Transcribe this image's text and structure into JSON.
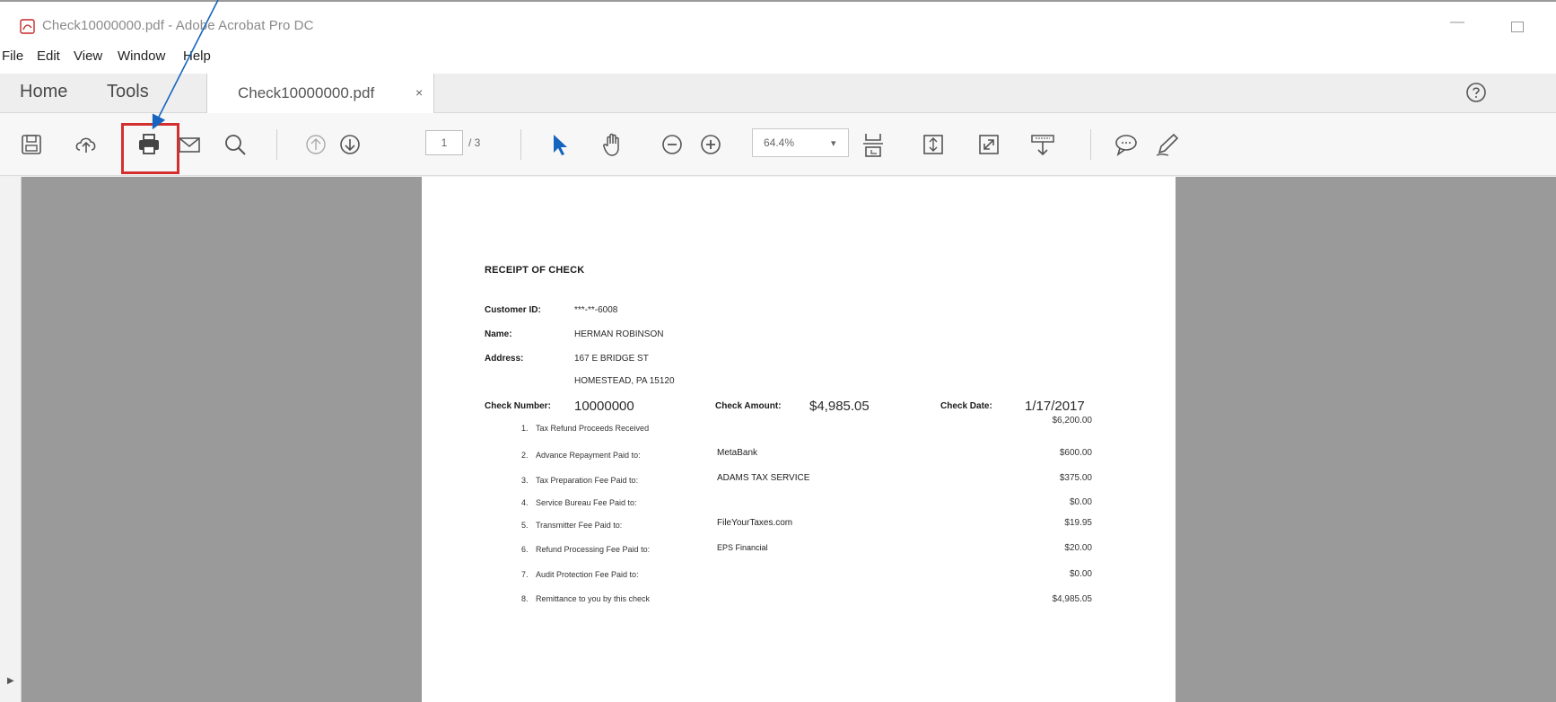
{
  "window": {
    "title": "Check10000000.pdf - Adobe Acrobat Pro DC"
  },
  "menu": [
    "File",
    "Edit",
    "View",
    "Window",
    "Help"
  ],
  "tabs": {
    "home": "Home",
    "tools": "Tools",
    "document": "Check10000000.pdf",
    "close": "×"
  },
  "toolbar": {
    "icons": [
      "save-icon",
      "cloud-upload-icon",
      "print-icon",
      "mail-icon",
      "search-icon",
      "page-up-icon",
      "page-down-icon",
      "select-arrow-icon",
      "hand-tool-icon",
      "zoom-out-icon",
      "zoom-in-icon",
      "fit-page-icon",
      "scroll-mode-icon",
      "full-screen-icon",
      "read-mode-icon",
      "comment-icon",
      "pen-icon"
    ],
    "page_current": "1",
    "page_total": "/ 3",
    "zoom": "64.4%",
    "highlight_color": "#d32f2f",
    "accent": "#1565c0"
  },
  "document": {
    "title": "RECEIPT OF CHECK",
    "customer_id_label": "Customer ID:",
    "customer_id": "***-**-6008",
    "name_label": "Name:",
    "name": "HERMAN ROBINSON",
    "address_label": "Address:",
    "address_line1": "167 E BRIDGE ST",
    "address_line2": "HOMESTEAD, PA 15120",
    "check_number_label": "Check Number:",
    "check_number": "10000000",
    "check_amount_label": "Check Amount:",
    "check_amount": "$4,985.05",
    "check_date_label": "Check Date:",
    "check_date": "1/17/2017",
    "items": [
      {
        "num": "1.",
        "label": "Tax Refund Proceeds Received",
        "payee": "",
        "amount": "$6,200.00"
      },
      {
        "num": "2.",
        "label": "Advance Repayment Paid to:",
        "payee": "MetaBank",
        "amount": "$600.00"
      },
      {
        "num": "3.",
        "label": "Tax Preparation Fee Paid to:",
        "payee": "ADAMS TAX SERVICE",
        "amount": "$375.00"
      },
      {
        "num": "4.",
        "label": "Service Bureau Fee Paid to:",
        "payee": "",
        "amount": "$0.00"
      },
      {
        "num": "5.",
        "label": "Transmitter Fee Paid to:",
        "payee": "FileYourTaxes.com",
        "amount": "$19.95"
      },
      {
        "num": "6.",
        "label": "Refund Processing Fee Paid to:",
        "payee": "EPS Financial",
        "amount": "$20.00"
      },
      {
        "num": "7.",
        "label": "Audit Protection Fee Paid to:",
        "payee": "",
        "amount": "$0.00"
      },
      {
        "num": "8.",
        "label": "Remittance to you by this check",
        "payee": "",
        "amount": "$4,985.05"
      }
    ]
  }
}
